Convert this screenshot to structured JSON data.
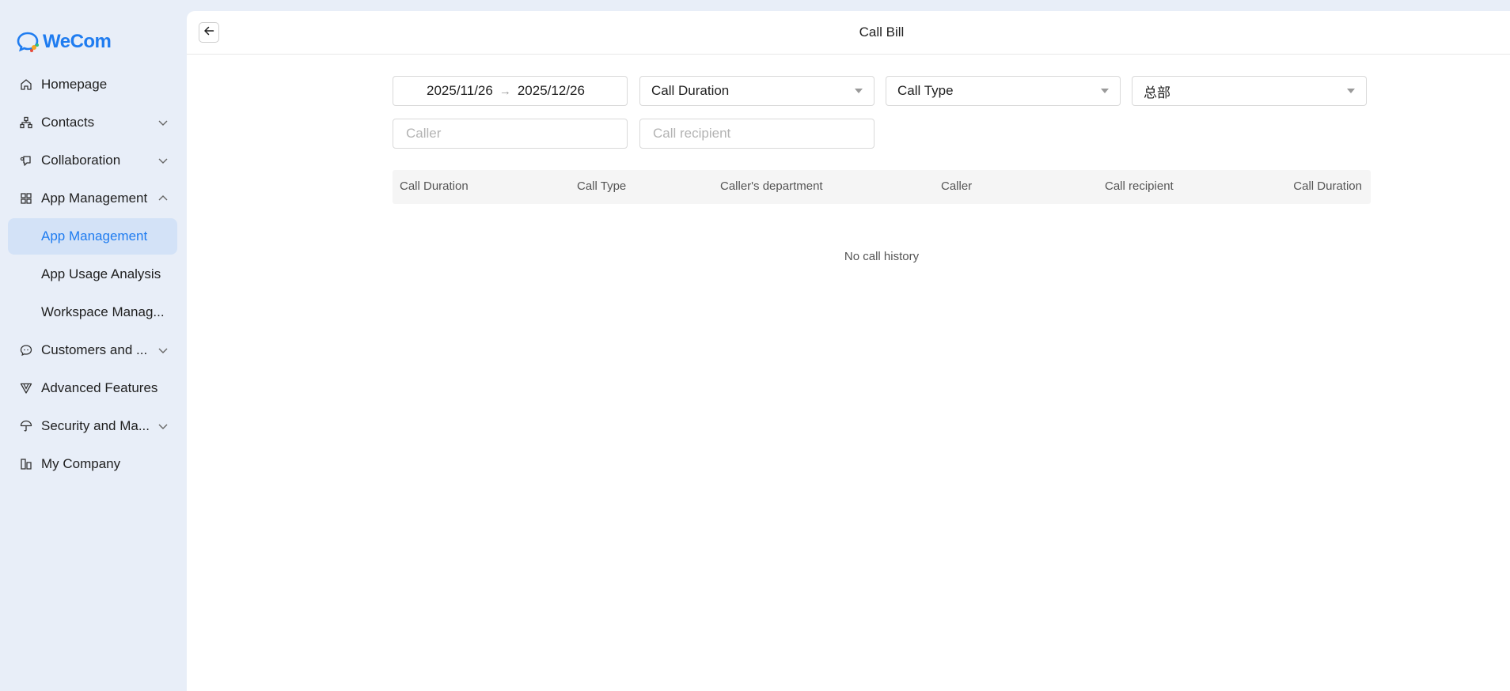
{
  "app": {
    "logo_text": "WeCom",
    "brand_color": "#1f7cf0"
  },
  "sidebar": {
    "items": [
      {
        "label": "Homepage",
        "icon": "home-icon"
      },
      {
        "label": "Contacts",
        "icon": "org-chart-icon",
        "chevron": "down"
      },
      {
        "label": "Collaboration",
        "icon": "collaboration-icon",
        "chevron": "down"
      },
      {
        "label": "App Management",
        "icon": "grid-icon",
        "chevron": "up"
      },
      {
        "label": "App Management",
        "sub": true,
        "active": true
      },
      {
        "label": "App Usage Analysis",
        "sub": true
      },
      {
        "label": "Workspace Manag...",
        "sub": true
      },
      {
        "label": "Customers and ...",
        "icon": "chat-bubble-icon",
        "chevron": "down"
      },
      {
        "label": "Advanced Features",
        "icon": "triangle-icon"
      },
      {
        "label": "Security and Ma...",
        "icon": "umbrella-icon",
        "chevron": "down"
      },
      {
        "label": "My Company",
        "icon": "building-icon"
      }
    ]
  },
  "header": {
    "title": "Call Bill"
  },
  "filters": {
    "date_start": "2025/11/26",
    "date_end": "2025/12/26",
    "call_duration": "Call Duration",
    "call_type": "Call Type",
    "department": "总部",
    "caller_placeholder": "Caller",
    "recipient_placeholder": "Call recipient"
  },
  "table": {
    "columns": [
      "Call Duration",
      "Call Type",
      "Caller's department",
      "Caller",
      "Call recipient",
      "Call Duration"
    ],
    "empty_text": "No call history"
  }
}
